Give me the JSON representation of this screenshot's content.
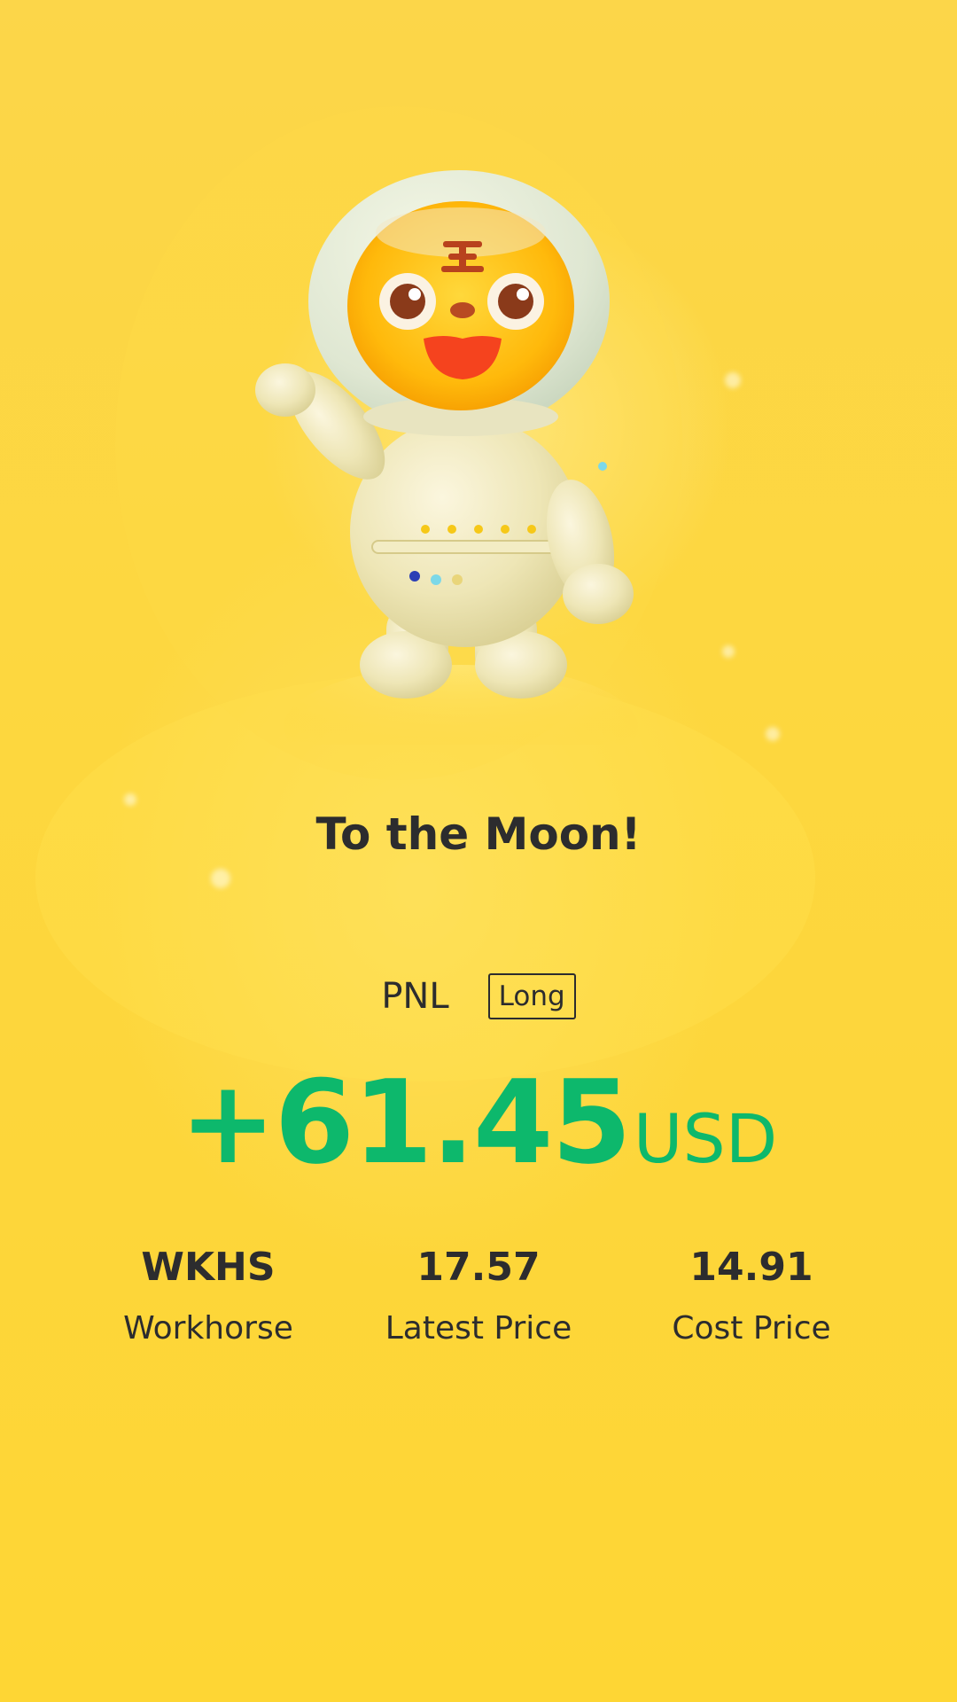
{
  "headline": "To the Moon!",
  "pnl": {
    "label": "PNL",
    "position_badge": "Long",
    "value": "+61.45",
    "unit": "USD",
    "color": "#0db86c"
  },
  "stats": [
    {
      "value": "WKHS",
      "label": "Workhorse"
    },
    {
      "value": "17.57",
      "label": "Latest Price"
    },
    {
      "value": "14.91",
      "label": "Cost Price"
    }
  ],
  "illustration": "tiger-astronaut-mascot",
  "colors": {
    "background": "#fdd43c",
    "text": "#2c2c2e",
    "profit": "#0db86c"
  }
}
